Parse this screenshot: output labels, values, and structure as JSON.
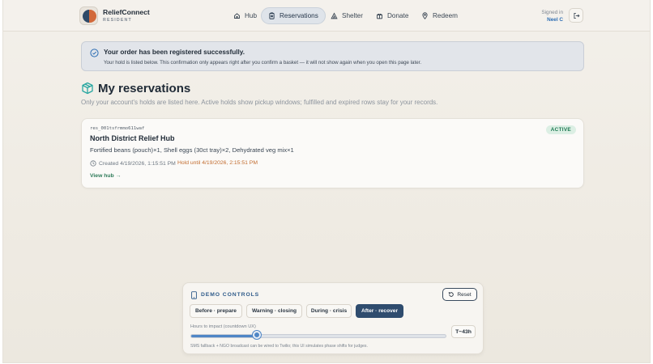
{
  "brand": {
    "name": "ReliefConnect",
    "role": "RESIDENT"
  },
  "nav": [
    {
      "label": "Hub",
      "icon": "home-icon"
    },
    {
      "label": "Reservations",
      "icon": "clipboard-icon",
      "active": true
    },
    {
      "label": "Shelter",
      "icon": "tent-icon"
    },
    {
      "label": "Donate",
      "icon": "gift-icon"
    },
    {
      "label": "Redeem",
      "icon": "map-pin-icon"
    }
  ],
  "account": {
    "signed_in_label": "Signed in",
    "user": "Neel C"
  },
  "notice": {
    "title": "Your order has been registered successfully.",
    "body": "Your hold is listed below. This confirmation only appears right after you confirm a basket — it will not show again when you open this page later."
  },
  "page": {
    "title": "My reservations",
    "subtitle": "Only your account's holds are listed here. Active holds show pickup windows; fulfilled and expired rows stay for your records."
  },
  "reservations": [
    {
      "id": "res_001tsfrmmo611waf",
      "status": "ACTIVE",
      "hub": "North District Relief Hub",
      "items": "Fortified beans (pouch)×1, Shell eggs (30ct tray)×2, Dehydrated veg mix×1",
      "created": "Created 4/19/2026, 1:15:51 PM",
      "hold_until": "Hold until 4/19/2026, 2:15:51 PM",
      "view_link": "View hub →"
    }
  ],
  "demo": {
    "title": "DEMO CONTROLS",
    "reset_label": "Reset",
    "phases": [
      "Before · prepare",
      "Warning · closing",
      "During · crisis",
      "After · recover"
    ],
    "active_phase": "After · recover",
    "slider_label": "Hours to impact (countdown UX)",
    "slider_fraction": 0.26,
    "slider_value": "T−43h",
    "footer": "SMS fallback + NGO broadcast can be wired to Twilio; this UI simulates phase shifts for judges."
  },
  "colors": {
    "accent": "#2f4c6e",
    "active_badge": "#1e7a53",
    "hold": "#c26c2f",
    "link": "#2d7a58"
  }
}
